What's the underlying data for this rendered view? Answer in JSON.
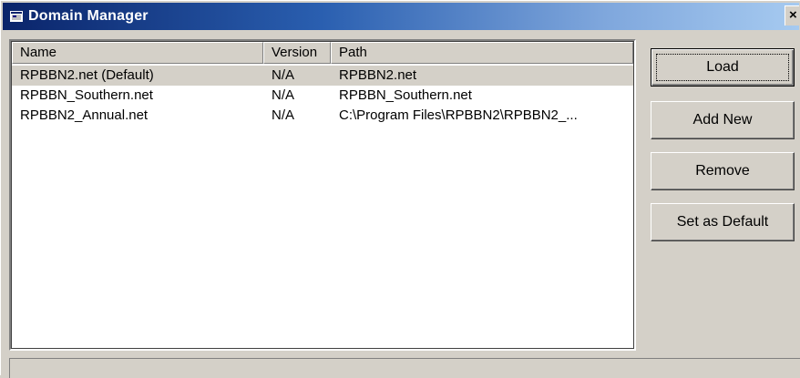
{
  "window": {
    "title": "Domain Manager",
    "close_label": "×"
  },
  "list": {
    "columns": [
      "Name",
      "Version",
      "Path"
    ],
    "rows": [
      {
        "name": "RPBBN2.net (Default)",
        "version": "N/A",
        "path": "RPBBN2.net",
        "selected": true
      },
      {
        "name": "RPBBN_Southern.net",
        "version": "N/A",
        "path": "RPBBN_Southern.net",
        "selected": false
      },
      {
        "name": "RPBBN2_Annual.net",
        "version": "N/A",
        "path": "C:\\Program Files\\RPBBN2\\RPBBN2_...",
        "selected": false
      }
    ]
  },
  "buttons": {
    "load": "Load",
    "add_new": "Add New",
    "remove": "Remove",
    "set_default": "Set as Default"
  },
  "status": {
    "text": ""
  },
  "icons": {
    "title": "domain-manager-icon",
    "close": "close-icon"
  },
  "colors": {
    "titlebar_start": "#0a246a",
    "titlebar_end": "#a6caf0",
    "face": "#d4d0c8",
    "selection": "#d4d0c8"
  }
}
